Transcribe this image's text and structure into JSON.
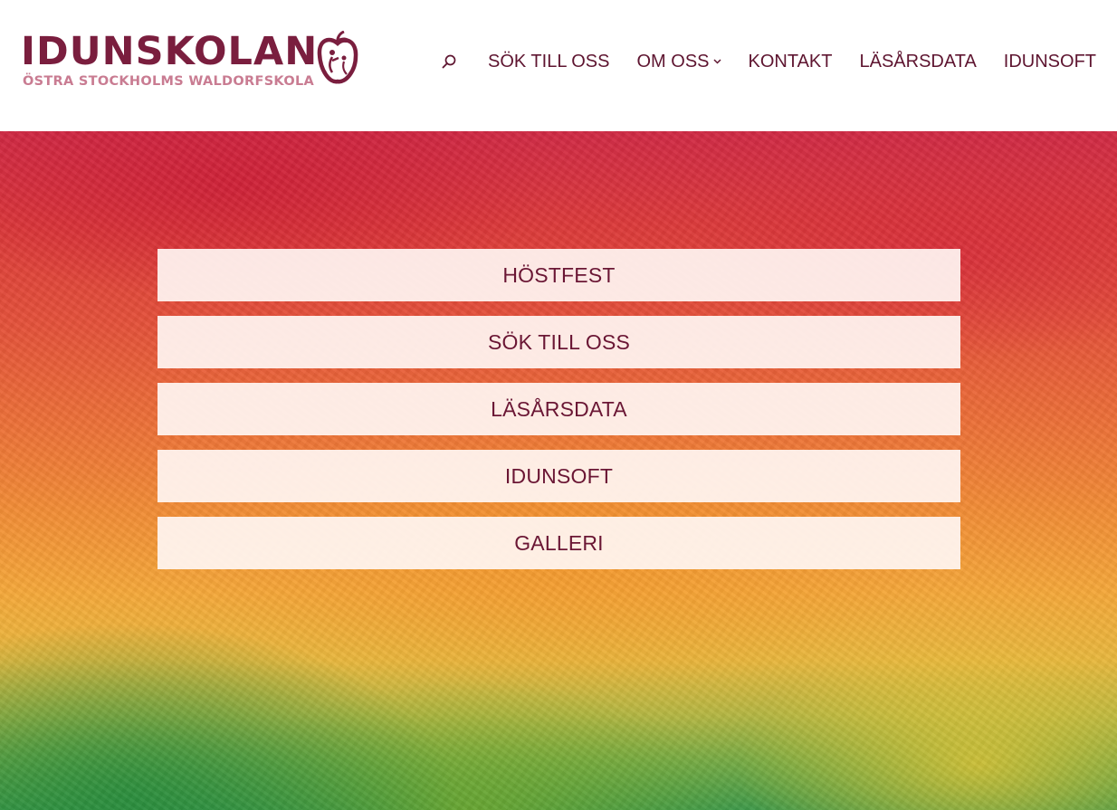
{
  "header": {
    "logo_title": "IDUNSKOLAN",
    "logo_subtitle": "ÖSTRA STOCKHOLMS WALDORFSKOLA",
    "search_icon": "search-icon",
    "nav": [
      {
        "label": "SÖK TILL OSS"
      },
      {
        "label": "OM OSS",
        "has_dropdown": true
      },
      {
        "label": "KONTAKT"
      },
      {
        "label": "LÄSÅRSDATA"
      },
      {
        "label": "IDUNSOFT"
      }
    ]
  },
  "hero": {
    "buttons": [
      {
        "label": "HÖSTFEST"
      },
      {
        "label": "SÖK TILL OSS"
      },
      {
        "label": "LÄSÅRSDATA"
      },
      {
        "label": "IDUNSOFT"
      },
      {
        "label": "GALLERI"
      }
    ]
  },
  "colors": {
    "brand": "#7a1e3e",
    "brand_light": "#c97c92",
    "nav_text": "#5e1530",
    "button_bg": "#fff6f3"
  }
}
